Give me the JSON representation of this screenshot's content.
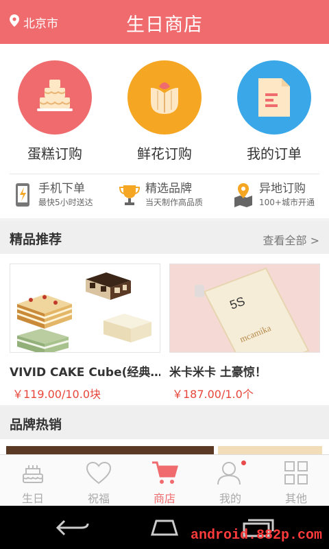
{
  "header": {
    "location": "北京市",
    "title": "生日商店"
  },
  "categories": [
    {
      "label": "蛋糕订购",
      "color": "#ef6b6e",
      "icon": "cake-icon"
    },
    {
      "label": "鲜花订购",
      "color": "#f5a623",
      "icon": "flower-icon"
    },
    {
      "label": "我的订单",
      "color": "#3aa8e8",
      "icon": "order-document-icon"
    }
  ],
  "features": [
    {
      "title": "手机下单",
      "subtitle": "最快5小时送达",
      "icon": "phone-lightning-icon"
    },
    {
      "title": "精选品牌",
      "subtitle": "当天制作高品质",
      "icon": "trophy-icon"
    },
    {
      "title": "异地订购",
      "subtitle": "100+城市开通",
      "icon": "map-pin-icon"
    }
  ],
  "featured": {
    "title": "精品推荐",
    "more": "查看全部 >"
  },
  "products": [
    {
      "name": "VIVID CAKE Cube(经典…",
      "price": "￥119.00/10.0块"
    },
    {
      "name": "米卡米卡 土豪惊！",
      "price": "￥187.00/1.0个"
    }
  ],
  "brand_hot": {
    "title": "品牌热销"
  },
  "tabs": [
    {
      "label": "生日",
      "icon": "birthday-cake-icon",
      "active": false
    },
    {
      "label": "祝福",
      "icon": "heart-icon",
      "active": false
    },
    {
      "label": "商店",
      "icon": "shopping-cart-icon",
      "active": true
    },
    {
      "label": "我的",
      "icon": "user-icon",
      "active": false
    },
    {
      "label": "其他",
      "icon": "grid-icon",
      "active": false
    }
  ],
  "watermark": "android.882p.com",
  "colors": {
    "accent": "#ef6b6e",
    "price": "#e8463a"
  }
}
